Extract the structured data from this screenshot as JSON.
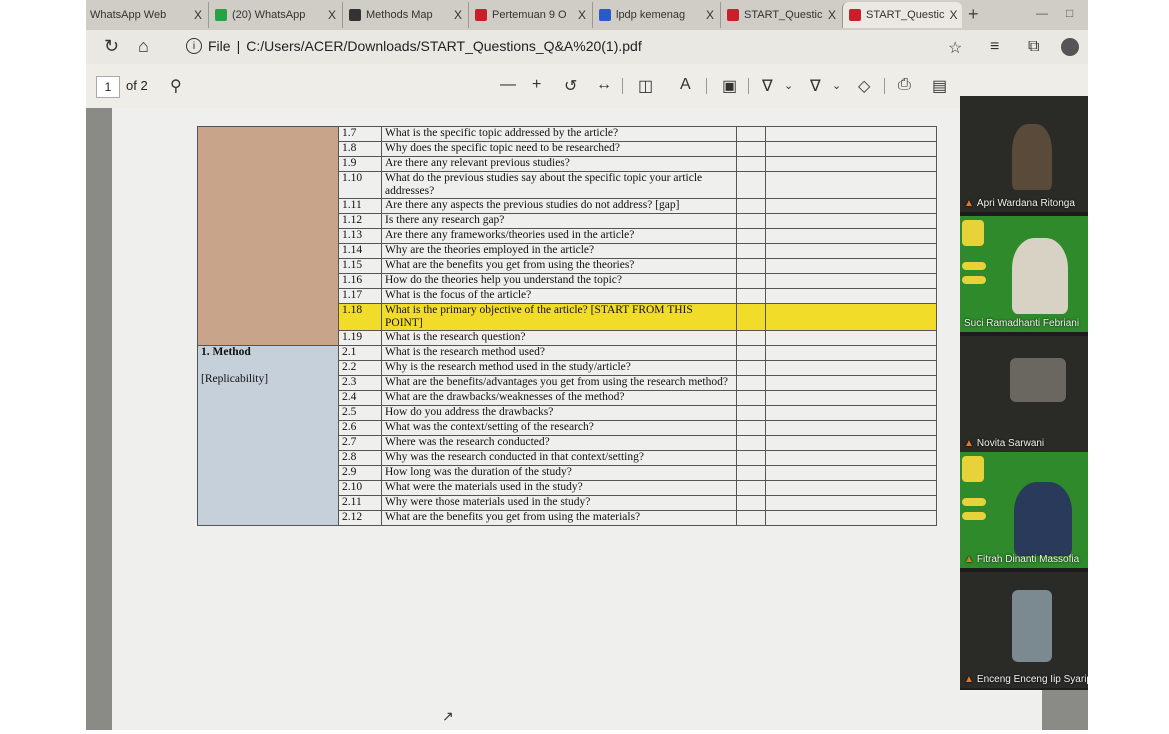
{
  "browser": {
    "tabs": [
      {
        "label": "WhatsApp Web",
        "color": "#25a244"
      },
      {
        "label": "(20) WhatsApp",
        "color": "#25a244"
      },
      {
        "label": "Methods Map",
        "color": "#333333"
      },
      {
        "label": "Pertemuan 9 O",
        "color": "#c8202a"
      },
      {
        "label": "lpdp kemenag",
        "color": "#2a5ac8"
      },
      {
        "label": "START_Questic",
        "color": "#c8202a"
      },
      {
        "label": "START_Questic",
        "color": "#c8202a"
      }
    ],
    "active_tab_index": 6,
    "tab_close": "X",
    "new_tab": "+",
    "address": {
      "scheme_label": "File",
      "separator": "|",
      "url": "C:/Users/ACER/Downloads/START_Questions_Q&A%20(1).pdf"
    }
  },
  "pdf_toolbar": {
    "page_current": "1",
    "page_total": "of 2",
    "icons": [
      "search-icon",
      "zoom-out-icon",
      "zoom-in-icon",
      "rotate-icon",
      "fit-width-icon",
      "page-view-icon",
      "read-aloud-icon",
      "text-box-icon",
      "draw-icon",
      "highlight-icon",
      "eraser-icon",
      "print-icon",
      "save-icon"
    ]
  },
  "document": {
    "rows": [
      {
        "num": "1.7",
        "q": "What is the specific topic addressed by the article?"
      },
      {
        "num": "1.8",
        "q": "Why does the specific topic need to be researched?"
      },
      {
        "num": "1.9",
        "q": "Are there any relevant previous studies?"
      },
      {
        "num": "1.10",
        "q": "What do the previous studies say about the specific topic your article addresses?"
      },
      {
        "num": "1.11",
        "q": "Are there any aspects the previous studies do not address? [gap]"
      },
      {
        "num": "1.12",
        "q": "Is there any research gap?"
      },
      {
        "num": "1.13",
        "q": "Are there any frameworks/theories used in the article?"
      },
      {
        "num": "1.14",
        "q": "Why are the theories employed in the article?"
      },
      {
        "num": "1.15",
        "q": "What are the benefits you get from using the theories?"
      },
      {
        "num": "1.16",
        "q": "How do the theories help you understand the topic?"
      },
      {
        "num": "1.17",
        "q": "What is the focus of the article?"
      },
      {
        "num": "1.18",
        "q": "What is the primary objective of the article? [START FROM THIS POINT]",
        "highlight": true
      },
      {
        "num": "1.19",
        "q": "What is the research question?"
      },
      {
        "num": "2.1",
        "q": "What is the research method used?"
      },
      {
        "num": "2.2",
        "q": "Why is the research method used in the study/article?"
      },
      {
        "num": "2.3",
        "q": "What are the benefits/advantages you get from using the research method?"
      },
      {
        "num": "2.4",
        "q": "What are the drawbacks/weaknesses of the method?"
      },
      {
        "num": "2.5",
        "q": "How do you address the drawbacks?"
      },
      {
        "num": "2.6",
        "q": "What was the context/setting of the research?"
      },
      {
        "num": "2.7",
        "q": "Where was the research conducted?"
      },
      {
        "num": "2.8",
        "q": "Why was the research conducted in that context/setting?"
      },
      {
        "num": "2.9",
        "q": "How long was the duration of the study?"
      },
      {
        "num": "2.10",
        "q": "What were the materials used in the study?"
      },
      {
        "num": "2.11",
        "q": "Why were those materials used in the study?"
      },
      {
        "num": "2.12",
        "q": "What are the benefits you get from using the materials?"
      }
    ],
    "method_section": {
      "title": "1. Method",
      "subtitle": "[Replicability]"
    }
  },
  "participants": [
    {
      "name": "Apri Wardana Ritonga"
    },
    {
      "name": "Suci Ramadhanti Febriani"
    },
    {
      "name": "Novita Sarwani"
    },
    {
      "name": "Fitrah Dinanti Massofia"
    },
    {
      "name": "Enceng Enceng Iip Syaripudin"
    }
  ],
  "colors": {
    "highlight": "#f2dc2a",
    "section_intro": "#c8a58a",
    "section_method": "#c5d0da"
  }
}
